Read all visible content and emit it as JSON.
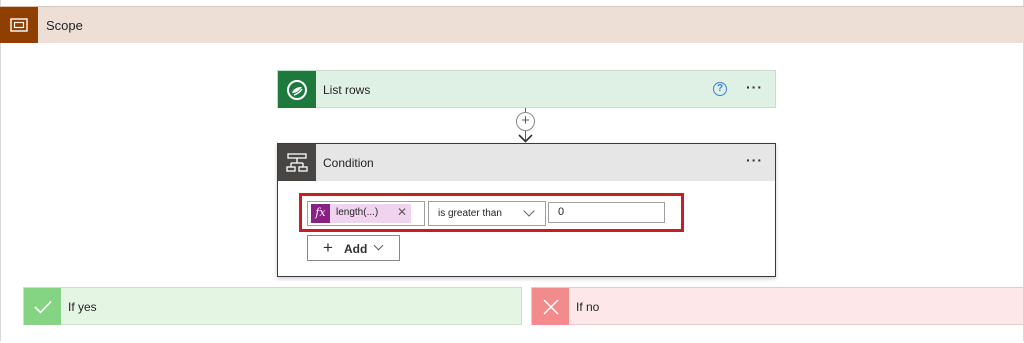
{
  "scope": {
    "title": "Scope",
    "icon": "scope-icon"
  },
  "list_rows": {
    "title": "List rows",
    "icon": "dataverse-icon",
    "help": "?",
    "more": "···"
  },
  "connector": {
    "add_symbol": "+"
  },
  "condition": {
    "title": "Condition",
    "icon": "condition-icon",
    "more": "···",
    "token": {
      "fx": "fx",
      "label": "length(...)",
      "remove": "✕"
    },
    "operator": "is greater than",
    "value": "0",
    "add_button": {
      "plus": "+",
      "label": "Add"
    }
  },
  "branches": {
    "yes": {
      "title": "If yes",
      "icon": "check-icon"
    },
    "no": {
      "title": "If no",
      "icon": "close-icon"
    }
  },
  "colors": {
    "scope_header": "#eddfd6",
    "scope_icon": "#8f3f00",
    "list_rows_bg": "#dff0e5",
    "dataverse_green": "#1e7a3c",
    "condition_icon": "#484644",
    "highlight": "#c41e28",
    "fx_purple": "#8a1f87",
    "yes_bg": "#e5f5e3",
    "no_bg": "#fde7e9"
  }
}
